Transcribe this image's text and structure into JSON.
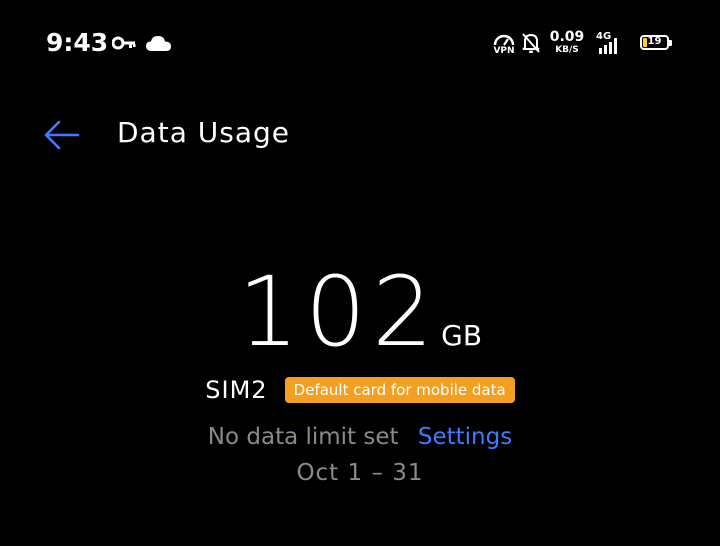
{
  "status_bar": {
    "time": "9:43",
    "vpn_label": "VPN",
    "speed_value": "0.09",
    "speed_unit": "KB/S",
    "network": "4G",
    "battery": "19",
    "battery_level": 0.19,
    "battery_color": "#ffd21f"
  },
  "header": {
    "title": "Data Usage"
  },
  "usage": {
    "value": "102",
    "unit": "GB"
  },
  "sim": {
    "label": "SIM2",
    "badge": "Default card for mobile data",
    "badge_color": "#f3a022"
  },
  "limit": {
    "text": "No data limit set",
    "link": "Settings",
    "link_color": "#3e7bff"
  },
  "period": "Oct 1 – 31",
  "icons": [
    "key-icon",
    "cloud-icon",
    "vpn-icon",
    "bell-off-icon",
    "signal-icon",
    "battery-icon",
    "back-arrow-icon"
  ]
}
